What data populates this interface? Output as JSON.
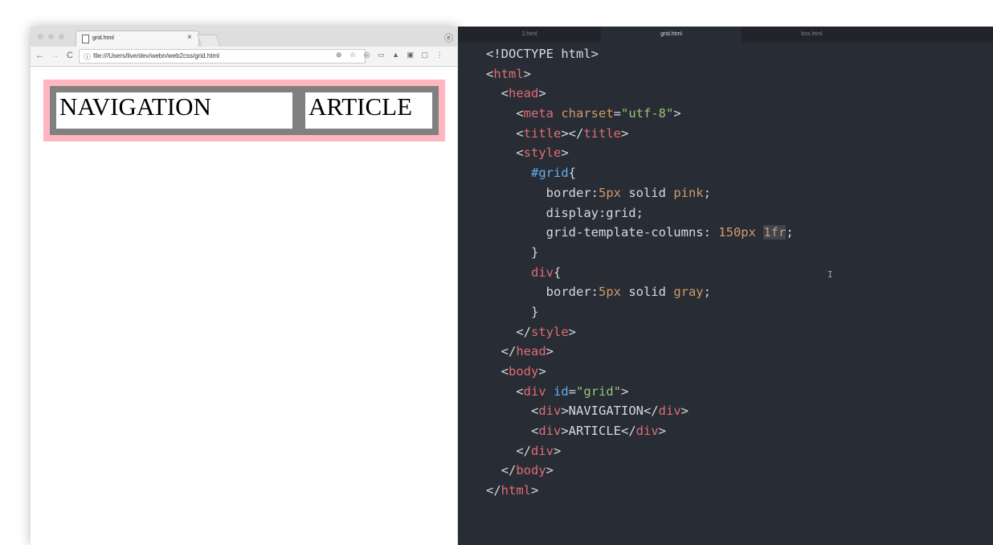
{
  "browser": {
    "tab_title": "grid.html",
    "tab_close": "×",
    "url": "file:///Users/live/dev/webn/web2css/grid.html",
    "back": "←",
    "forward": "→",
    "reload": "C",
    "info_icon": "ⓘ",
    "zoom_icon": "⊕",
    "star_icon": "☆",
    "profile_icon": "ⓔ"
  },
  "grid_items": [
    "NAVIGATION",
    "ARTICLE"
  ],
  "editor": {
    "tabs": [
      {
        "label": "2.html",
        "active": false
      },
      {
        "label": "grid.html",
        "active": true
      },
      {
        "label": "box.html",
        "active": false
      }
    ]
  },
  "code_lines": [
    [
      {
        "t": "<!DOCTYPE html>",
        "c": "p"
      }
    ],
    [
      {
        "t": "<",
        "c": "p"
      },
      {
        "t": "html",
        "c": "t"
      },
      {
        "t": ">",
        "c": "p"
      }
    ],
    [
      {
        "t": "  <",
        "c": "p"
      },
      {
        "t": "head",
        "c": "t"
      },
      {
        "t": ">",
        "c": "p"
      }
    ],
    [
      {
        "t": "    <",
        "c": "p"
      },
      {
        "t": "meta",
        "c": "t"
      },
      {
        "t": " ",
        "c": "p"
      },
      {
        "t": "charset",
        "c": "a"
      },
      {
        "t": "=",
        "c": "p"
      },
      {
        "t": "\"utf-8\"",
        "c": "s"
      },
      {
        "t": ">",
        "c": "p"
      }
    ],
    [
      {
        "t": "    <",
        "c": "p"
      },
      {
        "t": "title",
        "c": "t"
      },
      {
        "t": "></",
        "c": "p"
      },
      {
        "t": "title",
        "c": "t"
      },
      {
        "t": ">",
        "c": "p"
      }
    ],
    [
      {
        "t": "    <",
        "c": "p"
      },
      {
        "t": "style",
        "c": "t"
      },
      {
        "t": ">",
        "c": "p"
      }
    ],
    [
      {
        "t": "      ",
        "c": "p"
      },
      {
        "t": "#grid",
        "c": "id"
      },
      {
        "t": "{",
        "c": "p"
      }
    ],
    [
      {
        "t": "        border:",
        "c": "p"
      },
      {
        "t": "5px",
        "c": "a"
      },
      {
        "t": " solid ",
        "c": "p"
      },
      {
        "t": "pink",
        "c": "a"
      },
      {
        "t": ";",
        "c": "p"
      }
    ],
    [
      {
        "t": "        display:grid;",
        "c": "p"
      }
    ],
    [
      {
        "t": "        grid-template-columns: ",
        "c": "p"
      },
      {
        "t": "150px",
        "c": "a"
      },
      {
        "t": " ",
        "c": "p"
      },
      {
        "t": "1fr",
        "c": "a hl"
      },
      {
        "t": ";",
        "c": "p"
      }
    ],
    [
      {
        "t": "      }",
        "c": "p"
      }
    ],
    [
      {
        "t": "      ",
        "c": "p"
      },
      {
        "t": "div",
        "c": "t"
      },
      {
        "t": "{",
        "c": "p"
      }
    ],
    [
      {
        "t": "        border:",
        "c": "p"
      },
      {
        "t": "5px",
        "c": "a"
      },
      {
        "t": " solid ",
        "c": "p"
      },
      {
        "t": "gray",
        "c": "a"
      },
      {
        "t": ";",
        "c": "p"
      }
    ],
    [
      {
        "t": "      }",
        "c": "p"
      }
    ],
    [
      {
        "t": "    </",
        "c": "p"
      },
      {
        "t": "style",
        "c": "t"
      },
      {
        "t": ">",
        "c": "p"
      }
    ],
    [
      {
        "t": "  </",
        "c": "p"
      },
      {
        "t": "head",
        "c": "t"
      },
      {
        "t": ">",
        "c": "p"
      }
    ],
    [
      {
        "t": "  <",
        "c": "p"
      },
      {
        "t": "body",
        "c": "t"
      },
      {
        "t": ">",
        "c": "p"
      }
    ],
    [
      {
        "t": "    <",
        "c": "p"
      },
      {
        "t": "div",
        "c": "t"
      },
      {
        "t": " ",
        "c": "p"
      },
      {
        "t": "id",
        "c": "id"
      },
      {
        "t": "=",
        "c": "p"
      },
      {
        "t": "\"grid\"",
        "c": "s"
      },
      {
        "t": ">",
        "c": "p"
      }
    ],
    [
      {
        "t": "      <",
        "c": "p"
      },
      {
        "t": "div",
        "c": "t"
      },
      {
        "t": ">NAVIGATION</",
        "c": "p"
      },
      {
        "t": "div",
        "c": "t"
      },
      {
        "t": ">",
        "c": "p"
      }
    ],
    [
      {
        "t": "      <",
        "c": "p"
      },
      {
        "t": "div",
        "c": "t"
      },
      {
        "t": ">ARTICLE</",
        "c": "p"
      },
      {
        "t": "div",
        "c": "t"
      },
      {
        "t": ">",
        "c": "p"
      }
    ],
    [
      {
        "t": "    </",
        "c": "p"
      },
      {
        "t": "div",
        "c": "t"
      },
      {
        "t": ">",
        "c": "p"
      }
    ],
    [
      {
        "t": "  </",
        "c": "p"
      },
      {
        "t": "body",
        "c": "t"
      },
      {
        "t": ">",
        "c": "p"
      }
    ],
    [
      {
        "t": "</",
        "c": "p"
      },
      {
        "t": "html",
        "c": "t"
      },
      {
        "t": ">",
        "c": "p"
      }
    ]
  ],
  "colors": {
    "editor_bg": "#282c34",
    "tag": "#e06c75",
    "attr": "#d19a66",
    "string": "#98c379",
    "selector": "#61afef",
    "grid_border": "#ffb6c1",
    "item_border": "#808080"
  },
  "icons": {
    "cursor": "I-beam-cursor-icon"
  }
}
